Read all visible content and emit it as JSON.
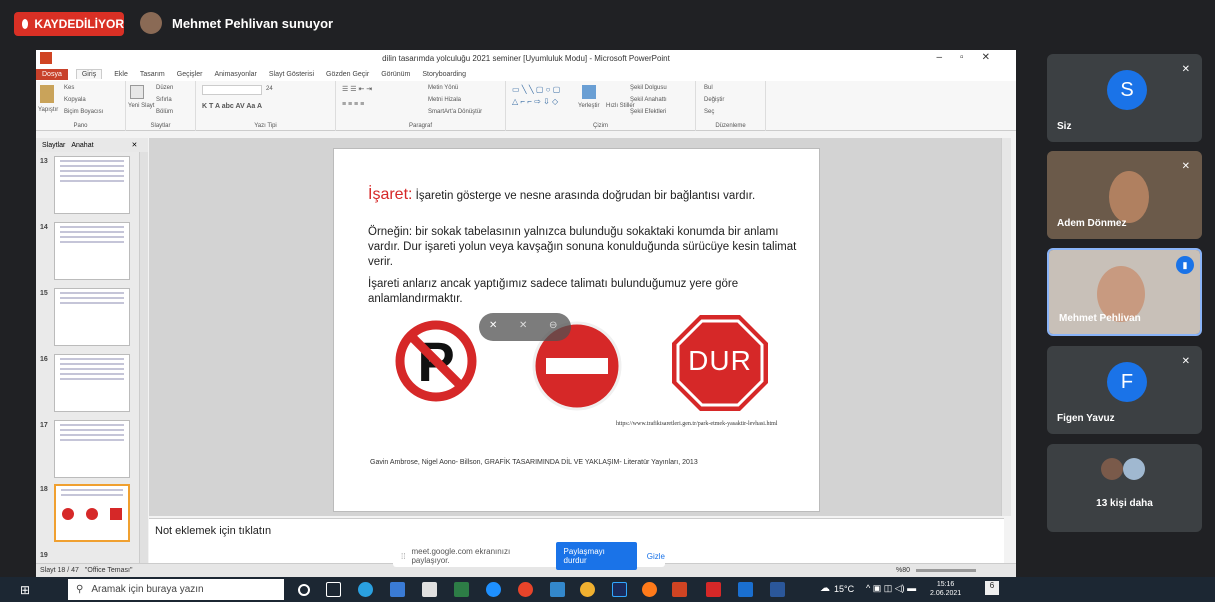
{
  "meet": {
    "recording_label": "KAYDEDİLİYOR",
    "presenter_label": "Mehmet Pehlivan sunuyor",
    "participants": [
      {
        "name": "Siz",
        "initial": "S",
        "color": "#1a73e8"
      },
      {
        "name": "Adem Dönmez"
      },
      {
        "name": "Mehmet Pehlivan"
      },
      {
        "name": "Figen Yavuz",
        "initial": "F",
        "color": "#1a73e8"
      }
    ],
    "more_label": "13 kişi daha",
    "share_text": "meet.google.com ekranınızı paylaşıyor.",
    "stop_label": "Paylaşmayı durdur",
    "hide_label": "Gizle"
  },
  "ppt": {
    "window_title": "dilin tasarımda yolculuğu 2021 seminer [Uyumluluk Modu] - Microsoft PowerPoint",
    "tabs": [
      "Dosya",
      "Giriş",
      "Ekle",
      "Tasarım",
      "Geçişler",
      "Animasyonlar",
      "Slayt Gösterisi",
      "Gözden Geçir",
      "Görünüm",
      "Storyboarding"
    ],
    "ribbon_groups": [
      "Pano",
      "Slaytlar",
      "Yazı Tipi",
      "Paragraf",
      "Çizim",
      "Düzenleme"
    ],
    "ribbon_items": {
      "paste": "Yapıştır",
      "cut": "Kes",
      "copy": "Kopyala",
      "format_painter": "Biçim Boyacısı",
      "new_slide": "Yeni Slayt",
      "layout": "Düzen",
      "reset": "Sıfırla",
      "section": "Bölüm",
      "text_direction": "Metin Yönü",
      "align_text": "Metni Hizala",
      "smartart": "SmartArt'a Dönüştür",
      "arrange": "Yerleştir",
      "quick_styles": "Hızlı Stiller",
      "shape_fill": "Şekil Dolgusu",
      "shape_outline": "Şekil Anahattı",
      "shape_effects": "Şekil Efektleri",
      "find": "Bul",
      "replace": "Değiştir",
      "select": "Seç",
      "font_size": "24"
    },
    "panel_tabs": [
      "Slaytlar",
      "Anahat"
    ],
    "slide_numbers": [
      "13",
      "14",
      "15",
      "16",
      "17",
      "18",
      "19"
    ],
    "notes_placeholder": "Not eklemek için tıklatın",
    "status_left": "Slayt 18 / 47",
    "status_theme": "\"Office Teması\"",
    "zoom": "%80"
  },
  "slide": {
    "heading": "İşaret:",
    "line1": "İşaretin gösterge ve nesne arasında doğrudan bir bağlantısı vardır.",
    "para2": "Örneğin: bir sokak tabelasının yalnızca bulunduğu sokaktaki konumda bir anlamı vardır. Dur işareti yolun veya kavşağın sonuna konulduğunda sürücüye kesin talimat verir.",
    "para3": "İşareti anlarız ancak yaptığımız sadece talimatı bulunduğumuz yere göre anlamlandırmaktır.",
    "stop_text": "DUR",
    "url": "https://www.trafikisaretleri.gen.tr/park-etmek-yasaktir-levhasi.html",
    "citation": "Gavin Ambrose, Nigel Aono- Billson, GRAFİK TASARIMINDA DİL VE YAKLAŞIM- Literatür Yayınları, 2013"
  },
  "taskbar": {
    "search_placeholder": "Aramak için buraya yazın",
    "temperature": "15°C",
    "time": "15:16",
    "date": "2.06.2021",
    "notif_count": "6"
  }
}
